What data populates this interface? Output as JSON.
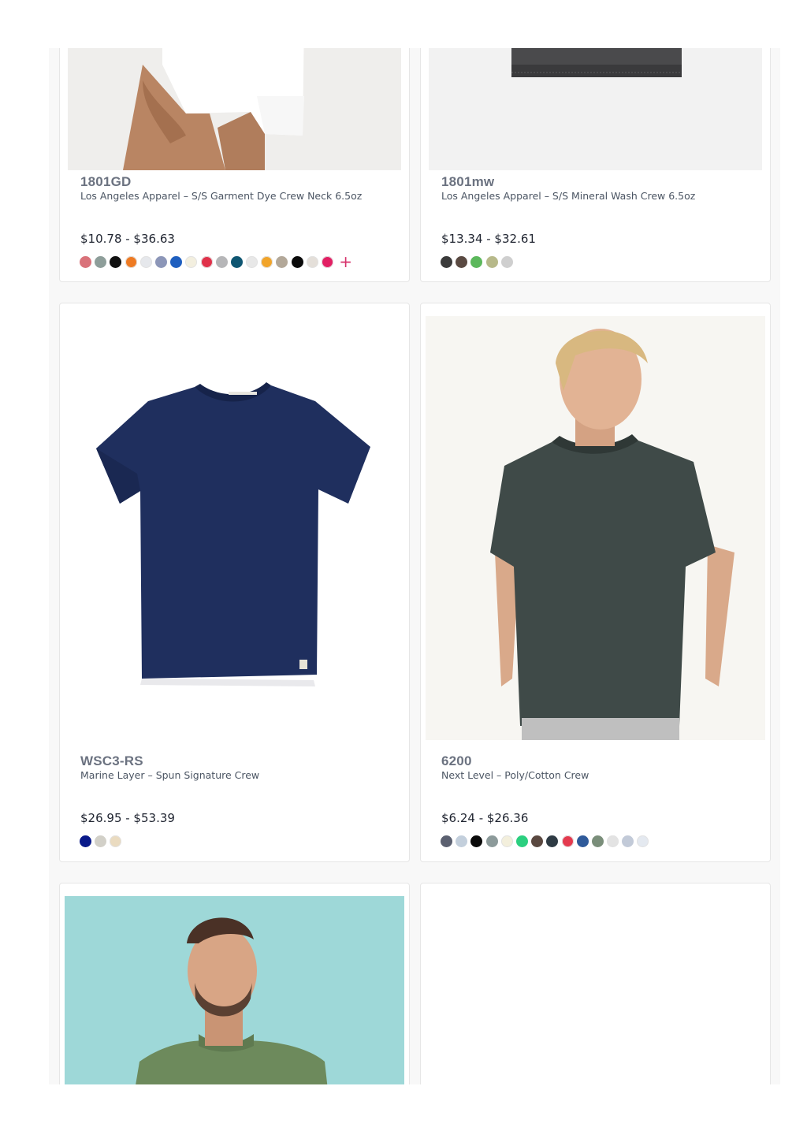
{
  "products": [
    {
      "sku": "1801GD",
      "name": "Los Angeles Apparel – S/S Garment Dye Crew Neck 6.5oz",
      "price": "$10.78 - $36.63",
      "swatches": [
        "#d9727a",
        "#8e9e9a",
        "#111111",
        "#ee7a22",
        "#e6e8ec",
        "#8c96b8",
        "#1f5fbf",
        "#f3efdf",
        "#e0314a",
        "#b6b6b8",
        "#0f5672",
        "#e8e8e8",
        "#f1a42a",
        "#b3a899",
        "#0b0b0b",
        "#e4dfd9",
        "#e21f63"
      ],
      "more_label": "+"
    },
    {
      "sku": "1801mw",
      "name": "Los Angeles Apparel – S/S Mineral Wash Crew 6.5oz",
      "price": "$13.34 - $32.61",
      "swatches": [
        "#3b3b3b",
        "#5a4a42",
        "#5cb85c",
        "#b7b98a",
        "#cfcfcf"
      ]
    },
    {
      "sku": "WSC3-RS",
      "name": "Marine Layer – Spun Signature Crew",
      "price": "$26.95 - $53.39",
      "swatches": [
        "#0a1a8a",
        "#d2d0c8",
        "#eadbc0"
      ]
    },
    {
      "sku": "6200",
      "name": "Next Level – Poly/Cotton Crew",
      "price": "$6.24 - $26.36",
      "swatches": [
        "#5b6070",
        "#c3cfdc",
        "#0a0a0a",
        "#8c9a9a",
        "#f3efdc",
        "#2bcf7f",
        "#5a4840",
        "#2e3b44",
        "#e43a4e",
        "#2f5a9a",
        "#7a8e7a",
        "#e3e3e3",
        "#c2cad8",
        "#e4e9f0"
      ]
    }
  ],
  "colors": {
    "price_text": "#1f2430",
    "sku_text": "#6b7280",
    "more_accent": "#d6336c"
  }
}
